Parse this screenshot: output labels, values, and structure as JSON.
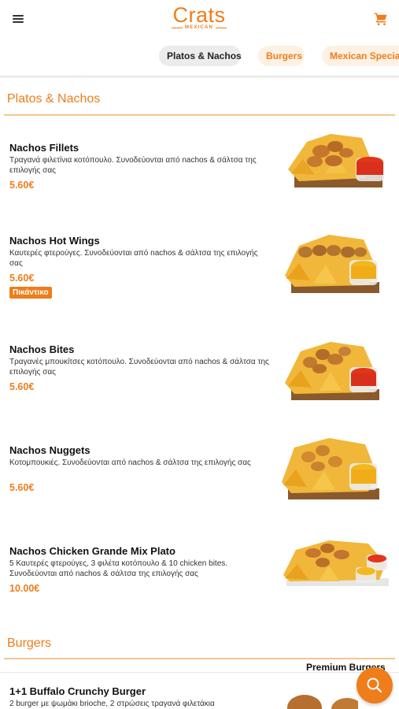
{
  "brand": {
    "name": "Crats",
    "sub": "MEXICAN",
    "color": "#ef7d1a"
  },
  "header": {
    "menu_icon": "hamburger-icon",
    "cart_icon": "cart-icon"
  },
  "tabs": [
    {
      "label": "Platos & Nachos",
      "active": true
    },
    {
      "label": "Burgers",
      "active": false
    },
    {
      "label": "Mexican Special",
      "active": false
    }
  ],
  "sections": [
    {
      "title": "Platos & Nachos",
      "items": [
        {
          "name": "Nachos Fillets",
          "description": "Τραγανά φιλετίνια κοτόπουλο. Συνοδεύονται από nachos & σάλτσα της επιλογής σας",
          "price": "5.60€",
          "image": "nachos-fillets-photo"
        },
        {
          "name": "Nachos Hot Wings",
          "description": "Καυτερές φτερούγες. Συνοδεύονται από nachos & σάλτσα της επιλογής σας",
          "price": "5.60€",
          "badge": "Πικάντικο",
          "image": "nachos-hot-wings-photo"
        },
        {
          "name": "Nachos Bites",
          "description": "Τραγανές μπουκίτσες κοτόπουλο. Συνοδεύονται από nachos & σάλτσα της επιλογής σας",
          "price": "5.60€",
          "image": "nachos-bites-photo"
        },
        {
          "name": "Nachos Nuggets",
          "description": "Κοτομπουκιές. Συνοδεύονται από nachos & σάλτσα της επιλογής σας",
          "price": "5.60€",
          "image": "nachos-nuggets-photo"
        },
        {
          "name": "Nachos Chicken Grande Mix Plato",
          "description": "5 Καυτερές φτερούγες, 3 φιλέτα κοτόπουλο & 10 chicken bites. Συνοδεύονται από nachos & σάλτσα της επιλογής σας",
          "price": "10.00€",
          "image": "nachos-grande-mix-photo"
        }
      ]
    },
    {
      "title": "Burgers",
      "subheading": "Premium Burgers",
      "items": [
        {
          "name": "1+1 Buffalo Crunchy Burger",
          "description": "2 burger με ψωμάκι brioche, 2 στρώσεις τραγανά φιλετάκια",
          "image": "buffalo-burger-photo"
        }
      ]
    }
  ],
  "fab": {
    "icon": "search-icon"
  }
}
